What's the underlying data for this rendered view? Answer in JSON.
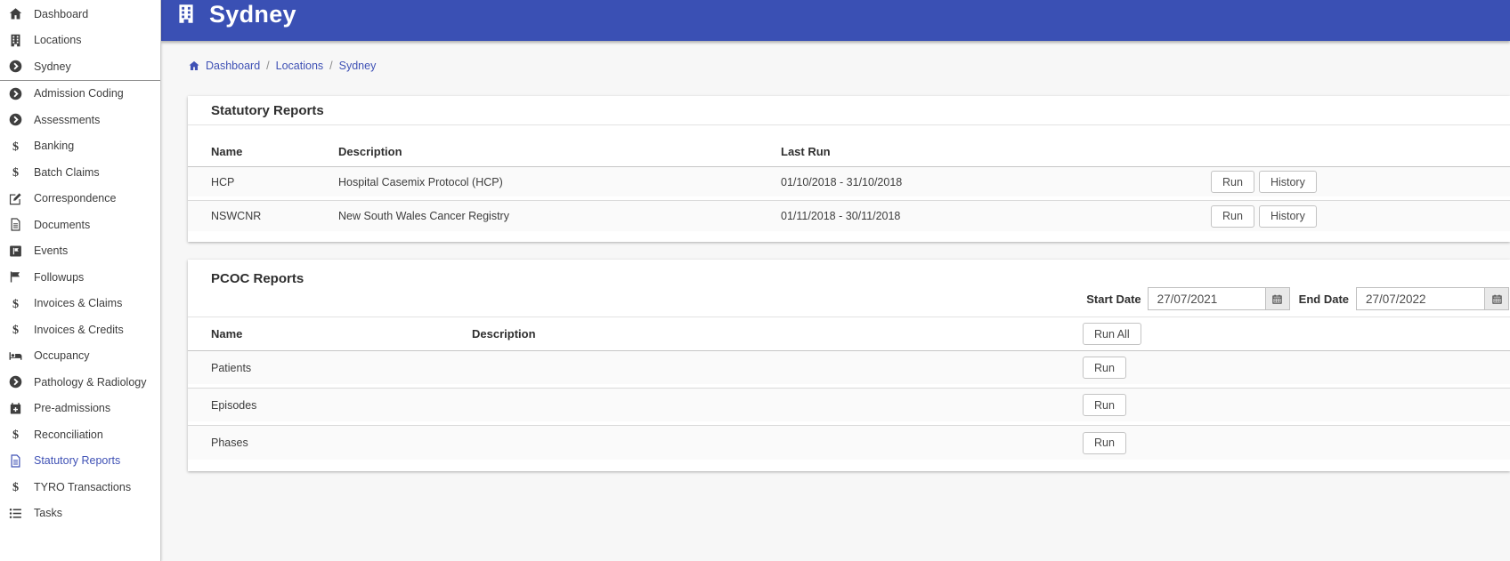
{
  "header": {
    "title": "Sydney",
    "icon": "building"
  },
  "breadcrumb": {
    "separator": "/",
    "items": [
      "Dashboard",
      "Locations",
      "Sydney"
    ]
  },
  "sidebar": {
    "items": [
      {
        "label": "Dashboard",
        "icon": "home"
      },
      {
        "label": "Locations",
        "icon": "building"
      },
      {
        "label": "Sydney",
        "icon": "arrow-circle-right"
      },
      {
        "label": "Admission Coding",
        "icon": "arrow-circle-right"
      },
      {
        "label": "Assessments",
        "icon": "arrow-circle-right"
      },
      {
        "label": "Banking",
        "icon": "dollar"
      },
      {
        "label": "Batch Claims",
        "icon": "dollar"
      },
      {
        "label": "Correspondence",
        "icon": "edit"
      },
      {
        "label": "Documents",
        "icon": "file"
      },
      {
        "label": "Events",
        "icon": "flag-square"
      },
      {
        "label": "Followups",
        "icon": "flag"
      },
      {
        "label": "Invoices & Claims",
        "icon": "dollar"
      },
      {
        "label": "Invoices & Credits",
        "icon": "dollar"
      },
      {
        "label": "Occupancy",
        "icon": "bed"
      },
      {
        "label": "Pathology & Radiology",
        "icon": "arrow-circle-right"
      },
      {
        "label": "Pre-admissions",
        "icon": "calendar-plus"
      },
      {
        "label": "Reconciliation",
        "icon": "dollar"
      },
      {
        "label": "Statutory Reports",
        "icon": "file",
        "active": true
      },
      {
        "label": "TYRO Transactions",
        "icon": "dollar"
      },
      {
        "label": "Tasks",
        "icon": "list"
      }
    ]
  },
  "statutory_reports": {
    "title": "Statutory Reports",
    "columns": {
      "name": "Name",
      "description": "Description",
      "last_run": "Last Run"
    },
    "run_label": "Run",
    "history_label": "History",
    "rows": [
      {
        "name": "HCP",
        "description": "Hospital Casemix Protocol (HCP)",
        "last_run": "01/10/2018 - 31/10/2018"
      },
      {
        "name": "NSWCNR",
        "description": "New South Wales Cancer Registry",
        "last_run": "01/11/2018 - 30/11/2018"
      }
    ]
  },
  "pcoc_reports": {
    "title": "PCOC Reports",
    "start_date": {
      "label": "Start Date",
      "value": "27/07/2021"
    },
    "end_date": {
      "label": "End Date",
      "value": "27/07/2022"
    },
    "columns": {
      "name": "Name",
      "description": "Description"
    },
    "run_all_label": "Run All",
    "run_label": "Run",
    "rows": [
      {
        "name": "Patients",
        "description": ""
      },
      {
        "name": "Episodes",
        "description": ""
      },
      {
        "name": "Phases",
        "description": ""
      }
    ]
  },
  "colors": {
    "header_bg": "#3a50b4",
    "accent": "#3f51b5",
    "row_bg": "#fafafa"
  }
}
